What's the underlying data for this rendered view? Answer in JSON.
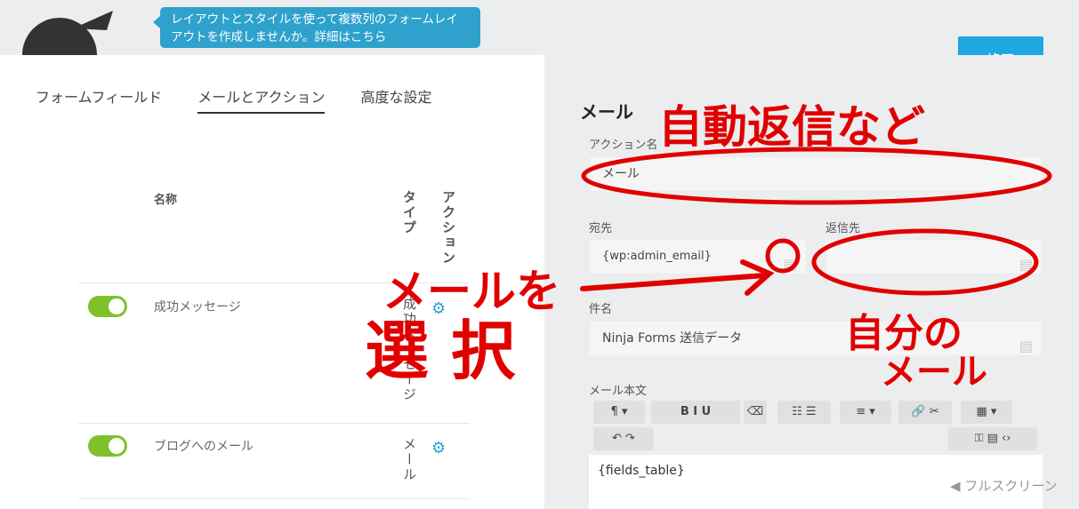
{
  "tooltip": {
    "text": "レイアウトとスタイルを使って複数列のフォームレイアウトを作成しませんか。詳細はこちら"
  },
  "done_label": "終了",
  "tabs": [
    {
      "label": "フォームフィールド"
    },
    {
      "label": "メールとアクション"
    },
    {
      "label": "高度な設定"
    }
  ],
  "table": {
    "col_name": "名称",
    "col_type": "タイプ",
    "col_action": "アクション",
    "rows": [
      {
        "name": "成功メッセージ",
        "type": "成功メッセージ"
      },
      {
        "name": "ブログへのメール",
        "type": "メール"
      }
    ]
  },
  "panel": {
    "title": "メール",
    "action_name_label": "アクション名",
    "action_name_value": "メール",
    "to_label": "宛先",
    "to_value": "{wp:admin_email}",
    "reply_label": "返信先",
    "reply_value": "",
    "subject_label": "件名",
    "subject_value": "Ninja Forms 送信データ",
    "body_label": "メール本文",
    "body_value": "{fields_table}",
    "fullscreen_label": "フルスクリーン"
  },
  "annotations": {
    "auto_reply": "自動返信など",
    "select_mail_1": "メールを",
    "select_mail_2": "選 択",
    "own_mail_1": "自分の",
    "own_mail_2": "メール"
  },
  "colors": {
    "accent": "#1ea7e1",
    "toggle_on": "#7dc12b",
    "annotation": "#e00000"
  }
}
